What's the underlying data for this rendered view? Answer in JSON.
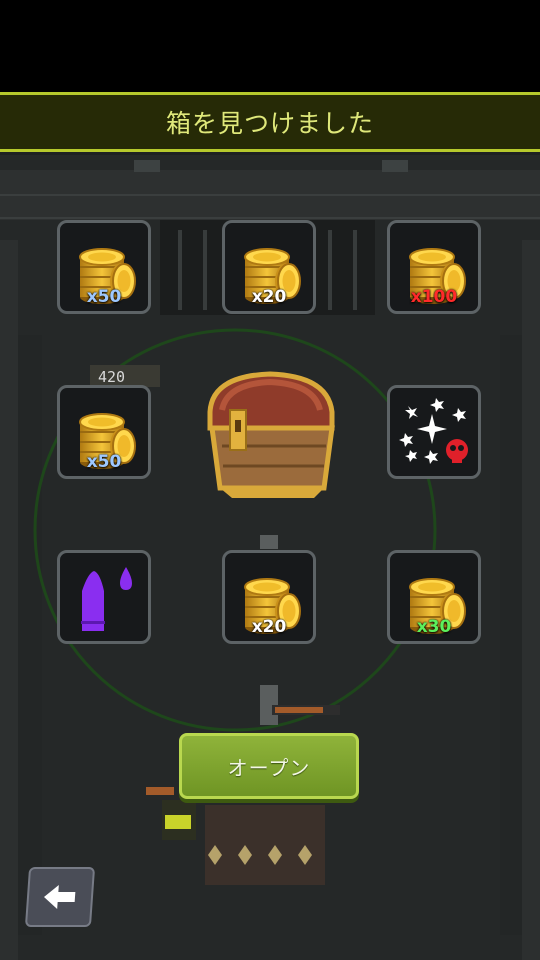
{
  "header": {
    "title": "箱を見つけました"
  },
  "rewards": [
    {
      "item": "gold-coins",
      "quantity": "x50",
      "quantity_color": "#9ec8ff"
    },
    {
      "item": "gold-coins",
      "quantity": "x20",
      "quantity_color": "#ffffff"
    },
    {
      "item": "gold-coins",
      "quantity": "x100",
      "quantity_color": "#ff2a2a"
    },
    {
      "item": "gold-coins",
      "quantity": "x50",
      "quantity_color": "#9ec8ff"
    },
    {
      "item": "shuriken-poison",
      "quantity": ""
    },
    {
      "item": "purple-bullet-ammo",
      "quantity": ""
    },
    {
      "item": "gold-coins",
      "quantity": "x20",
      "quantity_color": "#ffffff"
    },
    {
      "item": "gold-coins",
      "quantity": "x30",
      "quantity_color": "#5cf05c"
    }
  ],
  "background": {
    "counter": "420"
  },
  "actions": {
    "open_label": "オープン",
    "back_icon": "arrow-left-icon"
  },
  "colors": {
    "accent": "#b6c92c",
    "banner_text": "#dfe87a",
    "button": "#7fa52e"
  }
}
